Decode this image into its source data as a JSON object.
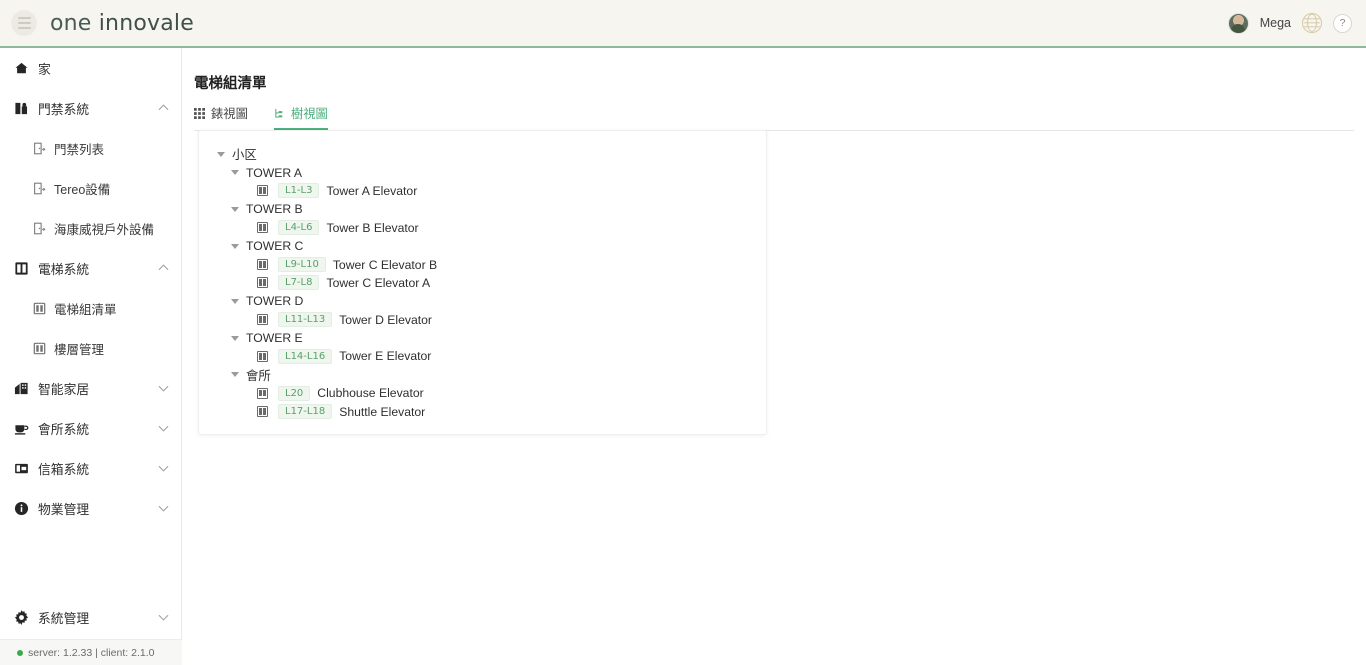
{
  "topbar": {
    "menu_icon": "hamburger-icon",
    "brand_word1": "one ",
    "brand_word2": "innovale",
    "username": "Mega",
    "language_icon": "globe-icon",
    "help_label": "?"
  },
  "sidebar": {
    "items": [
      {
        "label": "家",
        "icon": "home-icon",
        "level": 0,
        "chevron": ""
      },
      {
        "label": "門禁系統",
        "icon": "access-control-icon",
        "level": 0,
        "chevron": "up"
      },
      {
        "label": "門禁列表",
        "icon": "door-icon",
        "level": 1,
        "chevron": ""
      },
      {
        "label": "Tereo設備",
        "icon": "door-icon",
        "level": 1,
        "chevron": ""
      },
      {
        "label": "海康威視戶外設備",
        "icon": "door-icon",
        "level": 1,
        "chevron": ""
      },
      {
        "label": "電梯系統",
        "icon": "elevator-system-icon",
        "level": 0,
        "chevron": "up"
      },
      {
        "label": "電梯組清單",
        "icon": "elevator-icon",
        "level": 1,
        "chevron": ""
      },
      {
        "label": "樓層管理",
        "icon": "floor-icon",
        "level": 1,
        "chevron": ""
      },
      {
        "label": "智能家居",
        "icon": "smart-home-icon",
        "level": 0,
        "chevron": "down"
      },
      {
        "label": "會所系統",
        "icon": "clubhouse-icon",
        "level": 0,
        "chevron": "down"
      },
      {
        "label": "信箱系統",
        "icon": "mailbox-icon",
        "level": 0,
        "chevron": "down"
      },
      {
        "label": "物業管理",
        "icon": "info-icon",
        "level": 0,
        "chevron": "down"
      }
    ],
    "system_management": {
      "label": "系統管理",
      "icon": "gear-icon",
      "chevron": "down"
    },
    "footer": {
      "status": "server: 1.2.33 | client: 2.1.0",
      "status_color": "#3ea94b"
    }
  },
  "main": {
    "page_title": "電梯組清單",
    "tabs": [
      {
        "label": "錶視圖",
        "icon": "grid-icon",
        "active": false
      },
      {
        "label": "樹視圖",
        "icon": "tree-icon",
        "active": true
      }
    ],
    "accent_color": "#4caf7d",
    "tree": [
      {
        "type": "group",
        "level": 0,
        "label": "小区"
      },
      {
        "type": "group",
        "level": 1,
        "label": "TOWER A"
      },
      {
        "type": "elevator",
        "level": 2,
        "badge": "L1-L3",
        "name": "Tower A Elevator"
      },
      {
        "type": "group",
        "level": 1,
        "label": "TOWER B"
      },
      {
        "type": "elevator",
        "level": 2,
        "badge": "L4-L6",
        "name": "Tower B Elevator"
      },
      {
        "type": "group",
        "level": 1,
        "label": "TOWER C"
      },
      {
        "type": "elevator",
        "level": 2,
        "badge": "L9-L10",
        "name": "Tower C Elevator B"
      },
      {
        "type": "elevator",
        "level": 2,
        "badge": "L7-L8",
        "name": "Tower C Elevator A"
      },
      {
        "type": "group",
        "level": 1,
        "label": "TOWER D"
      },
      {
        "type": "elevator",
        "level": 2,
        "badge": "L11-L13",
        "name": "Tower D Elevator"
      },
      {
        "type": "group",
        "level": 1,
        "label": "TOWER E"
      },
      {
        "type": "elevator",
        "level": 2,
        "badge": "L14-L16",
        "name": "Tower E Elevator"
      },
      {
        "type": "group",
        "level": 1,
        "label": "會所"
      },
      {
        "type": "elevator",
        "level": 2,
        "badge": "L20",
        "name": "Clubhouse Elevator"
      },
      {
        "type": "elevator",
        "level": 2,
        "badge": "L17-L18",
        "name": "Shuttle Elevator"
      }
    ]
  }
}
